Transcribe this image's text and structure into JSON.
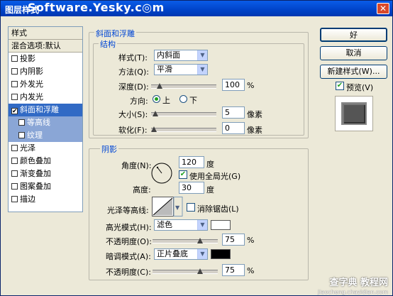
{
  "title": "图层样式",
  "watermark_top": "Software.Yesky.c◎m",
  "watermark_bottom": "查字典 教程网",
  "watermark_bottom_url": "jiaocheng.chazidian.com",
  "sidebar": {
    "items": [
      {
        "label": "样式",
        "checkbox": false,
        "checked": false,
        "type": "head"
      },
      {
        "label": "混合选项:默认",
        "checkbox": false,
        "checked": false,
        "type": "head"
      },
      {
        "label": "投影",
        "checkbox": true,
        "checked": false
      },
      {
        "label": "内阴影",
        "checkbox": true,
        "checked": false
      },
      {
        "label": "外发光",
        "checkbox": true,
        "checked": false
      },
      {
        "label": "内发光",
        "checkbox": true,
        "checked": false
      },
      {
        "label": "斜面和浮雕",
        "checkbox": true,
        "checked": true,
        "selected": true
      },
      {
        "label": "等高线",
        "checkbox": true,
        "checked": false,
        "sub": true
      },
      {
        "label": "纹理",
        "checkbox": true,
        "checked": false,
        "sub": true
      },
      {
        "label": "光泽",
        "checkbox": true,
        "checked": false
      },
      {
        "label": "颜色叠加",
        "checkbox": true,
        "checked": false
      },
      {
        "label": "渐变叠加",
        "checkbox": true,
        "checked": false
      },
      {
        "label": "图案叠加",
        "checkbox": true,
        "checked": false
      },
      {
        "label": "描边",
        "checkbox": true,
        "checked": false
      }
    ]
  },
  "bevel": {
    "group_title": "斜面和浮雕",
    "structure_title": "结构",
    "style_label": "样式(T):",
    "style_value": "内斜面",
    "technique_label": "方法(Q):",
    "technique_value": "平滑",
    "depth_label": "深度(D):",
    "depth_value": "100",
    "depth_unit": "%",
    "depth_fraction": 0.1,
    "direction_label": "方向:",
    "direction_up": "上",
    "direction_down": "下",
    "size_label": "大小(S):",
    "size_value": "5",
    "size_unit": "像素",
    "size_fraction": 0.02,
    "soften_label": "软化(F):",
    "soften_value": "0",
    "soften_unit": "像素",
    "soften_fraction": 0.0
  },
  "shading": {
    "title": "阴影",
    "angle_label": "角度(N):",
    "angle_value": "120",
    "angle_unit": "度",
    "global_light_label": "使用全局光(G)",
    "global_light_checked": true,
    "altitude_label": "高度:",
    "altitude_value": "30",
    "altitude_unit": "度",
    "gloss_contour_label": "光泽等高线:",
    "anti_alias_label": "消除锯齿(L)",
    "highlight_mode_label": "高光模式(H):",
    "highlight_mode_value": "滤色",
    "highlight_color": "#ffffff",
    "highlight_opacity_label": "不透明度(O):",
    "highlight_opacity_value": "75",
    "highlight_opacity_fraction": 0.75,
    "shadow_mode_label": "暗调模式(A):",
    "shadow_mode_value": "正片叠底",
    "shadow_color": "#000000",
    "shadow_opacity_label": "不透明度(C):",
    "shadow_opacity_value": "75",
    "shadow_opacity_fraction": 0.75,
    "percent": "%"
  },
  "buttons": {
    "ok": "好",
    "cancel": "取消",
    "new_style": "新建样式(W)...",
    "preview_label": "预览(V)",
    "preview_checked": true
  }
}
